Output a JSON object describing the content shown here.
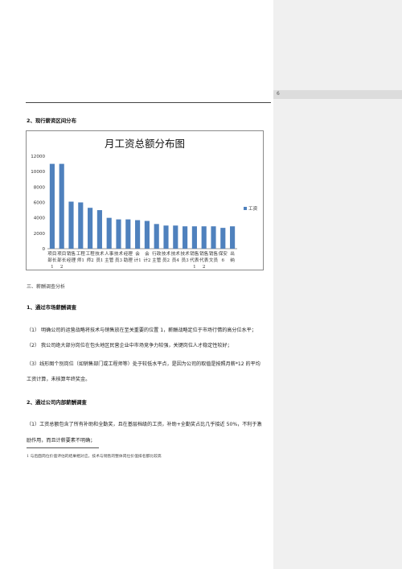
{
  "comment_marker": "6",
  "section1_heading": "2、现行薪资区间分布",
  "chart_data": {
    "type": "bar",
    "title": "月工资总额分布图",
    "ylim": [
      0,
      12000
    ],
    "yticks": [
      0,
      2000,
      4000,
      6000,
      8000,
      10000,
      12000
    ],
    "grid": false,
    "legend_position": "right",
    "bar_color": "#4f81bd",
    "series": [
      {
        "name": "工资",
        "values": [
          11000,
          11000,
          6100,
          6000,
          5300,
          5000,
          4000,
          3800,
          3800,
          3700,
          3600,
          3200,
          3000,
          3000,
          2900,
          2900,
          2900,
          2900,
          2700,
          2900
        ]
      }
    ],
    "categories": [
      [
        "项目",
        "部长",
        "1"
      ],
      [
        "项目",
        "部长",
        "2"
      ],
      [
        "销售",
        "经理",
        ""
      ],
      [
        "工程",
        "师1",
        ""
      ],
      [
        "工程",
        "师2",
        ""
      ],
      [
        "技术",
        "员1",
        ""
      ],
      [
        "人事",
        "主管",
        ""
      ],
      [
        "技术",
        "员3",
        ""
      ],
      [
        "经理",
        "助理",
        ""
      ],
      [
        "会",
        "计1",
        ""
      ],
      [
        "会",
        "计2",
        ""
      ],
      [
        "行政",
        "主管",
        ""
      ],
      [
        "技术",
        "员2",
        ""
      ],
      [
        "技术",
        "员4",
        ""
      ],
      [
        "技术",
        "员3",
        ""
      ],
      [
        "销售",
        "代表",
        "1"
      ],
      [
        "销售",
        "代表",
        "2"
      ],
      [
        "销售",
        "文员",
        ""
      ],
      [
        "保安",
        "6",
        ""
      ],
      [
        "出",
        "纳",
        ""
      ]
    ]
  },
  "section_note": "三、薪酬调查分析",
  "heading_market": "1、通过市场薪酬调查",
  "market_items": [
    "（1） 明确公司的运营战略将技术与销售放在至关重要的位置 1，薪酬战略定位于市场行情的高分位水平；",
    "（2） 我公司绝大部分岗位在包头地区民营企业中市场竞争力较强，关键岗位人才稳定性较好；",
    "（3）线形图个别岗位（如销售部门或工程师等）处于较低水平点，是因为公司的取值是按照月薪*12 的平均",
    "工资计算，未核算年终奖金。"
  ],
  "heading_internal": "2、通过公司内部薪酬调查",
  "internal_items": [
    "（1）工资总额包含了所有补助和全勤奖，且在基层档级的工资，补助+全勤奖占比几乎接近 50%，不利于激",
    "励作用，而且计薪要素不明确；"
  ],
  "footnote": "1 与后面岗位价值评估的结果相对应，技术与销售的整体岗位价值排名都比较高"
}
